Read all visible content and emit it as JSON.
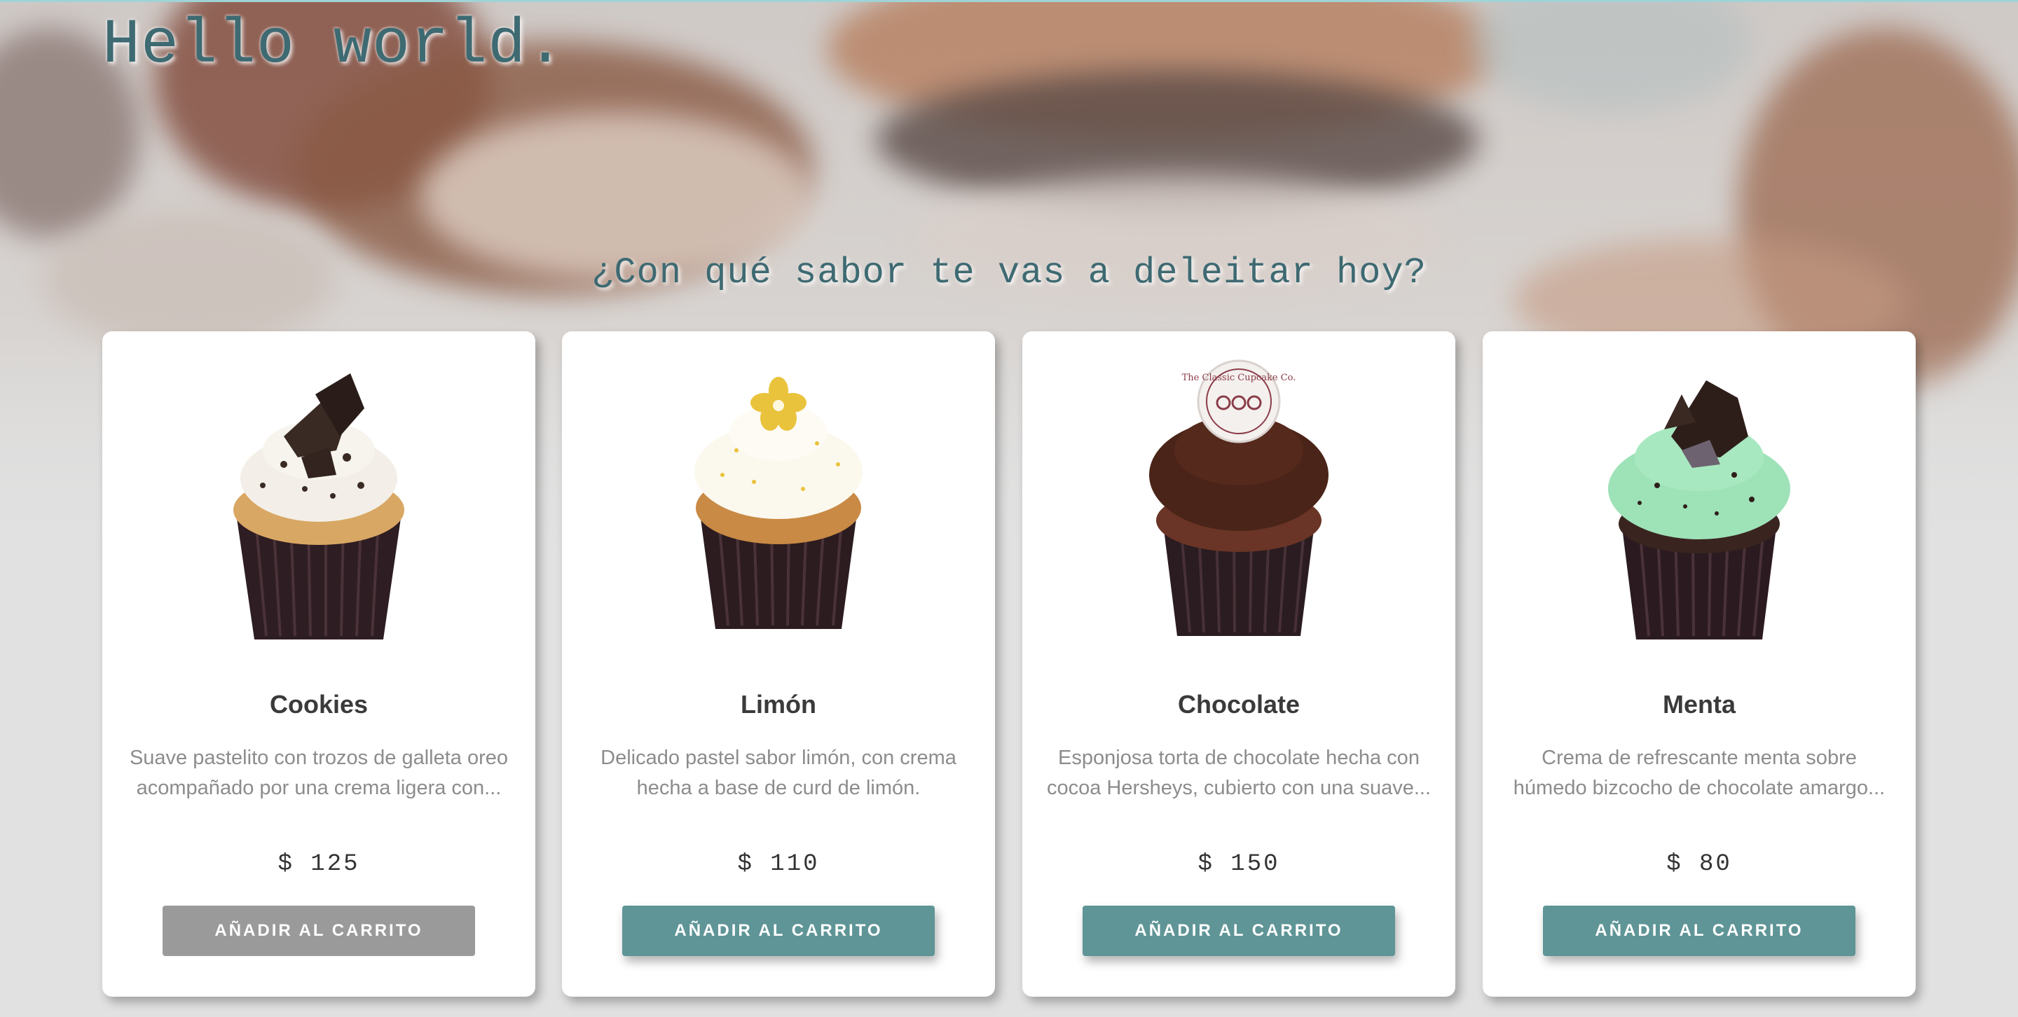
{
  "header": {
    "title": "Hello world.",
    "subtitle": "¿Con qué sabor te vas a deleitar hoy?"
  },
  "colors": {
    "accent": "#5f9597",
    "heading": "#3e6a72",
    "disabled_button": "#9a9a9a",
    "background": "#e1e1e1"
  },
  "products": [
    {
      "name": "Cookies",
      "description": "Suave pastelito con trozos de galleta oreo acompañado por una crema ligera con...",
      "price": "$ 125",
      "button_label": "AÑADIR AL CARRITO",
      "image": "cupcake-cookies-image",
      "frosting": "#f3efe8",
      "topping": "#3a2a24",
      "cake": "#d9a764"
    },
    {
      "name": "Limón",
      "description": "Delicado pastel sabor limón, con crema hecha a base de curd de limón.",
      "price": "$ 110",
      "button_label": "AÑADIR AL CARRITO",
      "image": "cupcake-lemon-image",
      "frosting": "#fbf8ee",
      "topping": "#e9c33b",
      "cake": "#c98a45"
    },
    {
      "name": "Chocolate",
      "description": "Esponjosa torta de chocolate hecha con cocoa Hersheys, cubierto con una suave...",
      "price": "$ 150",
      "button_label": "AÑADIR AL CARRITO",
      "image": "cupcake-chocolate-image",
      "frosting": "#4a2418",
      "topping": "#f4f0ee",
      "cake": "#6a3526",
      "medallion_text": "The Classic Cupcake Co."
    },
    {
      "name": "Menta",
      "description": "Crema de refrescante menta sobre húmedo bizcocho de chocolate amargo...",
      "price": "$ 80",
      "button_label": "AÑADIR AL CARRITO",
      "image": "cupcake-mint-image",
      "frosting": "#9ee2b8",
      "topping": "#2e1e1a",
      "cake": "#3a2420"
    }
  ]
}
